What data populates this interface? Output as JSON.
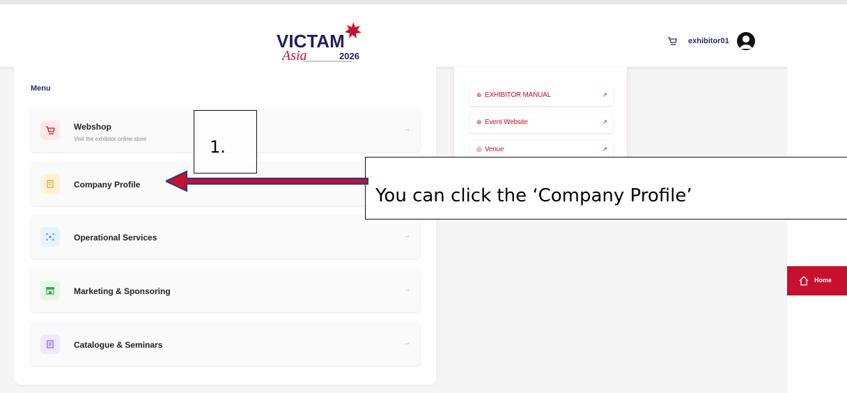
{
  "header": {
    "logo_alt": "VICTAM Asia 2026",
    "username": "exhibitor01",
    "cart_icon": "cart-icon",
    "avatar_icon": "user-avatar-icon"
  },
  "menu": {
    "title": "Menu",
    "items": [
      {
        "label": "Webshop",
        "sub": "Visit the exhibitor online store",
        "icon": "cart-icon",
        "color": "#ffe8ea"
      },
      {
        "label": "Company Profile",
        "sub": "",
        "icon": "building-icon",
        "color": "#fff1d6"
      },
      {
        "label": "Operational Services",
        "sub": "",
        "icon": "network-icon",
        "color": "#e6f2ff"
      },
      {
        "label": "Marketing & Sponsoring",
        "sub": "",
        "icon": "storefront-icon",
        "color": "#e6f7e6"
      },
      {
        "label": "Catalogue & Seminars",
        "sub": "",
        "icon": "book-icon",
        "color": "#f0e8ff"
      }
    ],
    "arrow": "→"
  },
  "links": [
    {
      "label": "EXHIBITOR MANUAL"
    },
    {
      "label": "Event Website"
    },
    {
      "label": "Venue"
    }
  ],
  "sidebar": {
    "home_label": "Home"
  },
  "annotation": {
    "step": "1.",
    "callout": "You can click the ‘Company Profile’"
  },
  "colors": {
    "brand_red": "#c8102e",
    "navy": "#2b2b6b"
  }
}
